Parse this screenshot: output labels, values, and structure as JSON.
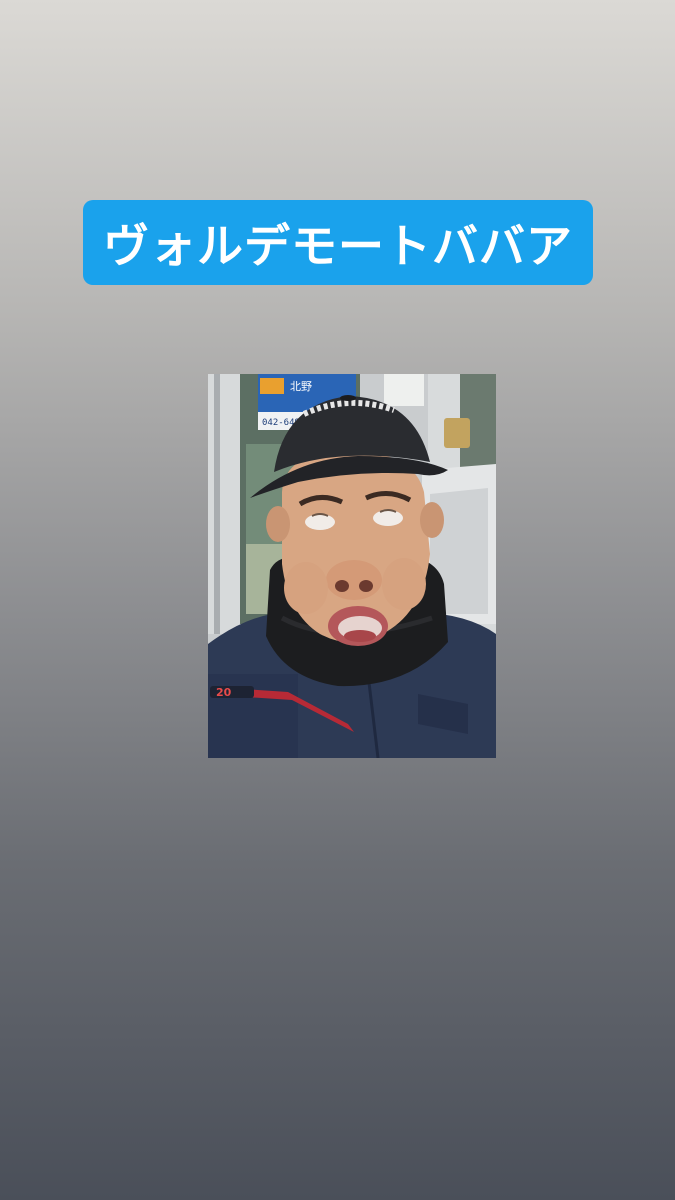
{
  "story": {
    "caption": "ヴォルデモートババア",
    "caption_color": "#1aa2ec",
    "caption_text_color": "#ffffff"
  },
  "photo": {
    "sign_text": "北野",
    "sign_phone": "042-649"
  }
}
